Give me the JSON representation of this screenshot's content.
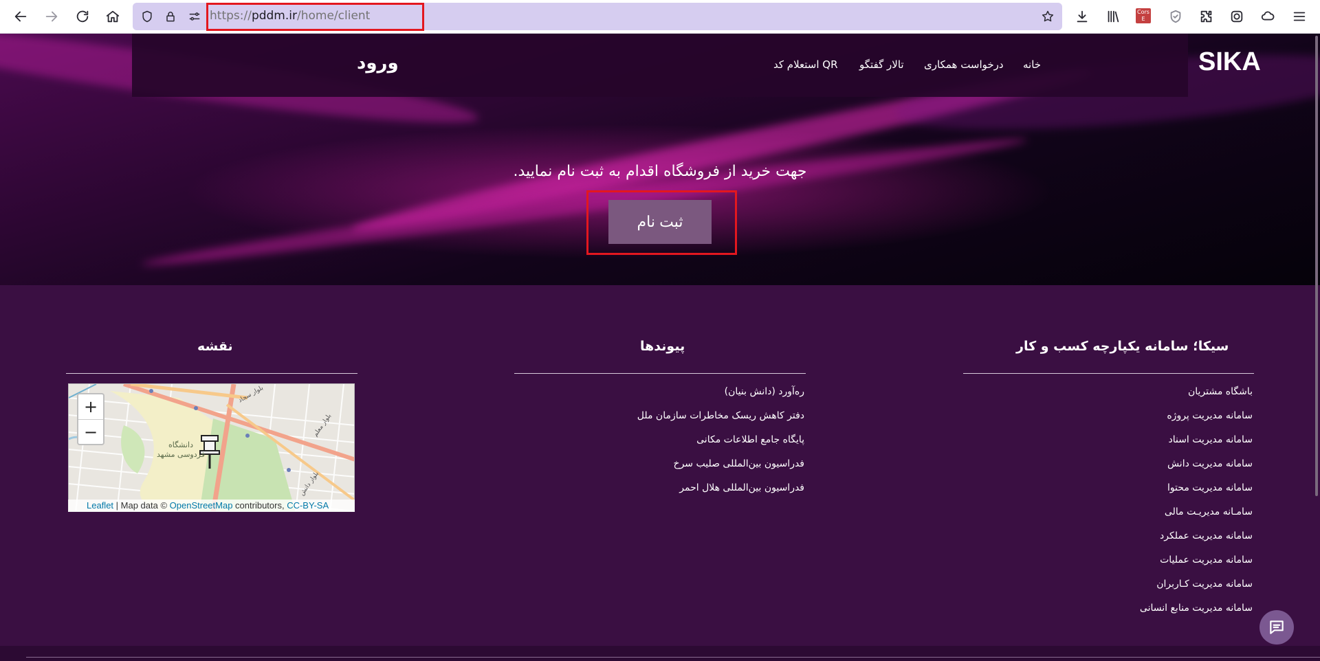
{
  "browser": {
    "url_scheme": "https://",
    "url_host": "pddm.ir",
    "url_path": "/home/client",
    "extension_badge": "Cors E"
  },
  "navbar": {
    "brand": "SIKA",
    "items": [
      {
        "label": "خانه"
      },
      {
        "label": "درخواست همکاری"
      },
      {
        "label": "تالار گفتگو"
      },
      {
        "label": "استعلام کد QR"
      }
    ],
    "login_label": "ورود"
  },
  "hero": {
    "message": "جهت خرید از فروشگاه اقدام به ثبت نام نمایید.",
    "register_label": "ثبت نام"
  },
  "footer": {
    "about": {
      "title": "سیکا؛ سامانه یکپارچه کسب و کار",
      "links": [
        "باشگاه مشتریان",
        "سامانه مدیریت پروژه",
        "سامانه مدیریت اسناد",
        "سامانه مدیریت دانش",
        "سامانه مدیریت محتوا",
        "سامـانه مدیریـت مالی",
        "سامانه مدیریت عملکرد",
        "سامانه مدیریت عملیات",
        "سامانه مدیریت کـاربران",
        "سامانه مدیریت منابع انسانی"
      ]
    },
    "links_section": {
      "title": "پیوندها",
      "links": [
        "ره‌آورد (دانش بنیان)",
        "دفتر کاهش ریسک مخاطرات سازمان ملل",
        "پایگاه جامع اطلاعات مکانی",
        "فدراسیون بین‌المللی صلیب سرخ",
        "فدراسیون بین‌المللی هلال احمر"
      ]
    },
    "map_section": {
      "title": "نقشه",
      "zoom_in": "+",
      "zoom_out": "−",
      "attribution_leaflet": "Leaflet",
      "attribution_sep": " | Map data © ",
      "attribution_osm": "OpenStreetMap",
      "attribution_contrib": " contributors, ",
      "attribution_license": "CC-BY-SA",
      "map_labels": [
        "دانشگاه فردوسی مشهد",
        "بلوار سجاد",
        "بلوار معلم",
        "بلوار دانش"
      ]
    }
  },
  "colors": {
    "footer_bg": "#3a0f42",
    "register_button": "#7b587f",
    "highlight": "#e3171f",
    "url_bar": "#d6cdf0"
  }
}
